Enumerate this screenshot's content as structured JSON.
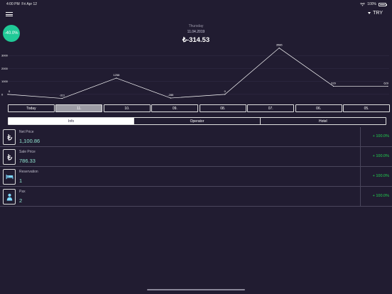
{
  "status": {
    "time": "4:00 PM",
    "date": "Fri Apr 12",
    "battery": "100%"
  },
  "header": {
    "currency": "TRY",
    "percent_change": "-40.0%",
    "day": "Thursday",
    "date": "11.04.2019",
    "amount": "₺-314.53"
  },
  "chart_data": {
    "type": "line",
    "categories": [
      "Today",
      "11.",
      "10.",
      "09.",
      "08.",
      "07.",
      "06.",
      "05."
    ],
    "values": [
      0,
      -311,
      1258,
      -285,
      0,
      3586,
      629,
      629
    ],
    "data_labels": [
      "0",
      "-311",
      "1258",
      "-285",
      "0",
      "3586",
      "629",
      "629"
    ],
    "y_ticks": [
      "3000",
      "2000",
      "1000",
      "0"
    ],
    "y_tick_values": [
      3000,
      2000,
      1000,
      0
    ],
    "ylim": [
      -500,
      4000
    ],
    "colors": {
      "line": "#ffffff",
      "text": "#ffffff",
      "grid": "#3a3550"
    }
  },
  "period_tabs": [
    {
      "label": "Today",
      "active": false
    },
    {
      "label": "11.",
      "active": true
    },
    {
      "label": "10.",
      "active": false
    },
    {
      "label": "09.",
      "active": false
    },
    {
      "label": "08.",
      "active": false
    },
    {
      "label": "07.",
      "active": false
    },
    {
      "label": "06.",
      "active": false
    },
    {
      "label": "05.",
      "active": false
    }
  ],
  "segments": [
    {
      "label": "Info",
      "active": true
    },
    {
      "label": "Operator",
      "active": false
    },
    {
      "label": "Hotel",
      "active": false
    }
  ],
  "metrics": [
    {
      "label": "Net Price",
      "value": "1,100.86",
      "change": "+ 100.0%",
      "icon": "lira-icon"
    },
    {
      "label": "Sale Price",
      "value": "786.33",
      "change": "+ 100.0%",
      "icon": "lira-icon"
    },
    {
      "label": "Reservation",
      "value": "1",
      "change": "+ 100.0%",
      "icon": "bed-icon"
    },
    {
      "label": "Pax",
      "value": "2",
      "change": "+ 100.0%",
      "icon": "person-icon"
    }
  ],
  "colors": {
    "background": "#211c31",
    "accent": "#20c997",
    "positive": "#22d24f",
    "value": "#8fe3cf"
  }
}
